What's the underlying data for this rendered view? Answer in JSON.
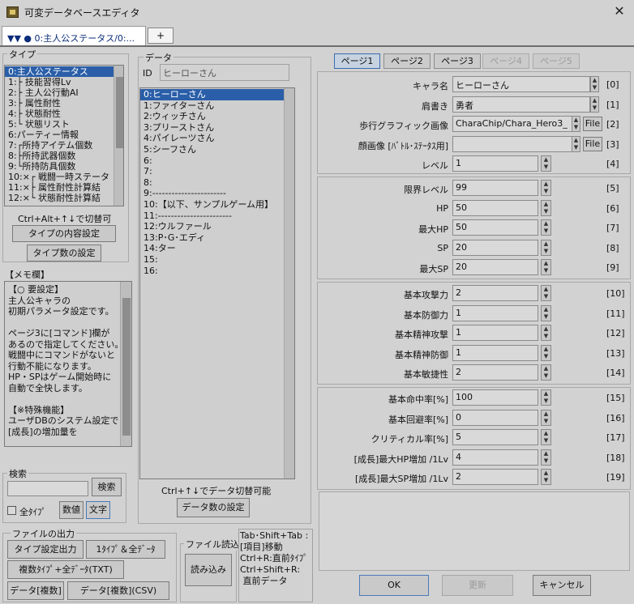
{
  "window": {
    "title": "可変データベースエディタ",
    "close_label": "✕"
  },
  "tabs": {
    "active_label": "▼▼ ● 0:主人公ステータス/0:...",
    "add_label": "+"
  },
  "type_panel": {
    "label": "タイプ",
    "items": [
      "0:主人公ステータス",
      "1:├ 技能習得Lv",
      "2:├ 主人公行動AI",
      "3:├ 属性耐性",
      "4:├ 状態耐性",
      "5:└ 状態リスト",
      "6:パーティー情報",
      "7:┌所持アイテム個数",
      "8:├所持武器個数",
      "9:└所持防具個数",
      "10:×┌ 戦闘一時ステータ",
      "11:×├ 属性耐性計算結",
      "12:×└ 状態耐性計算結"
    ],
    "hint": "Ctrl+Alt+↑↓で切替可",
    "content_btn": "タイプの内容設定",
    "count_btn": "タイプ数の設定"
  },
  "memo": {
    "label": "【メモ欄】",
    "text": "【○ 要設定】\n主人公キャラの\n初期パラメータ設定です。\n\nページ3に[コマンド]欄が\nあるので指定してください。\n戦闘中にコマンドがないと\n行動不能になります。\nHP・SPはゲーム開始時に\n自動で全快します。\n\n【※特殊機能】\nユーザDBのシステム設定で\n[成長]の増加量を"
  },
  "search": {
    "label": "検索",
    "button": "検索",
    "value": "",
    "all_types_label": "全ﾀｲﾌﾟ",
    "num_label": "数値",
    "text_label": "文字"
  },
  "file_out": {
    "label": "ファイルの出力",
    "b1": "タイプ設定出力",
    "b2": "1ﾀｲﾌﾟ＆全ﾃﾞｰﾀ",
    "b3": "複数ﾀｲﾌﾟ+全ﾃﾞｰﾀ(TXT)",
    "b4": "データ[複数]",
    "b5": "データ[複数](CSV)"
  },
  "file_in": {
    "label": "ファイル読込",
    "button": "読み込み"
  },
  "shortcut_text": "Tab･Shift+Tab :\n[項目]移動\nCtrl+R:直前ﾀｲﾌﾟ\nCtrl+Shift+R:\n 直前データ",
  "data_panel": {
    "label": "データ",
    "id_label": "ID",
    "id_value": "ヒーローさん",
    "items": [
      "0:ヒーローさん",
      "1:ファイターさん",
      "2:ウィッチさん",
      "3:プリーストさん",
      "4:パイレーツさん",
      "5:シーフさん",
      "6:",
      "7:",
      "8:",
      "9:-----------------------",
      "10:【以下、サンプルゲーム用】",
      "11:-----------------------",
      "12:ウルファール",
      "13:P･G･エディ",
      "14:ター",
      "15:",
      "16:"
    ],
    "hint": "Ctrl+↑↓でデータ切替可能",
    "count_btn": "データ数の設定"
  },
  "page_tabs": [
    "ページ1",
    "ページ2",
    "ページ3",
    "ページ4",
    "ページ5"
  ],
  "fields_text": [
    {
      "label": "キャラ名",
      "value": "ヒーローさん",
      "index": "[0]"
    },
    {
      "label": "肩書き",
      "value": "勇者",
      "index": "[1]"
    },
    {
      "label": "歩行グラフィック画像",
      "value": "CharaChip/Chara_Hero3_",
      "index": "[2]",
      "file": "File"
    },
    {
      "label": "顔画像 [ﾊﾞﾄﾙ･ｽﾃｰﾀｽ用]",
      "value": "",
      "index": "[3]",
      "file": "File"
    },
    {
      "label": "レベル",
      "value": "1",
      "index": "[4]"
    }
  ],
  "fields_g1": [
    {
      "label": "限界レベル",
      "value": "99",
      "index": "[5]"
    },
    {
      "label": "HP",
      "value": "50",
      "index": "[6]"
    },
    {
      "label": "最大HP",
      "value": "50",
      "index": "[7]"
    },
    {
      "label": "SP",
      "value": "20",
      "index": "[8]"
    },
    {
      "label": "最大SP",
      "value": "20",
      "index": "[9]"
    }
  ],
  "fields_g2": [
    {
      "label": "基本攻撃力",
      "value": "2",
      "index": "[10]"
    },
    {
      "label": "基本防御力",
      "value": "1",
      "index": "[11]"
    },
    {
      "label": "基本精神攻撃",
      "value": "1",
      "index": "[12]"
    },
    {
      "label": "基本精神防御",
      "value": "1",
      "index": "[13]"
    },
    {
      "label": "基本敏捷性",
      "value": "2",
      "index": "[14]"
    }
  ],
  "fields_g3": [
    {
      "label": "基本命中率[%]",
      "value": "100",
      "index": "[15]"
    },
    {
      "label": "基本回避率[%]",
      "value": "0",
      "index": "[16]"
    },
    {
      "label": "クリティカル率[%]",
      "value": "5",
      "index": "[17]"
    },
    {
      "label": "[成長]最大HP増加 /1Lv",
      "value": "4",
      "index": "[18]"
    },
    {
      "label": "[成長]最大SP増加 /1Lv",
      "value": "2",
      "index": "[19]"
    }
  ],
  "footer": {
    "ok": "OK",
    "update": "更新",
    "cancel": "キャンセル"
  }
}
